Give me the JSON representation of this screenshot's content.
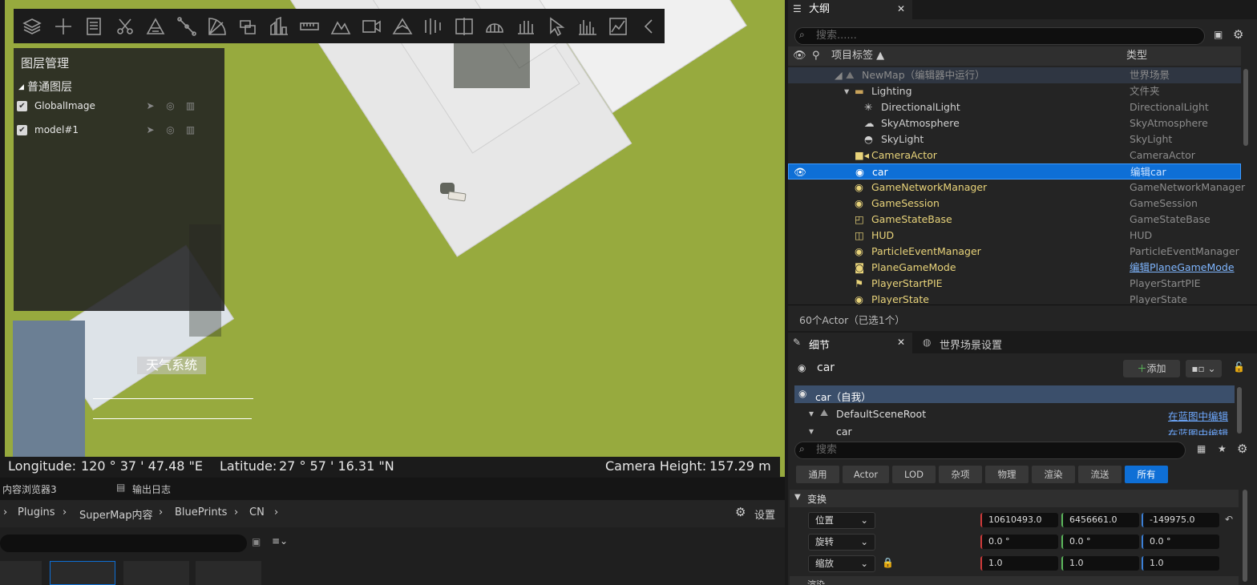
{
  "toolbar": {
    "icons": [
      "layers-icon",
      "plus-icon",
      "list-icon",
      "scissors-icon",
      "terrain-icon",
      "measure-icon",
      "sector-icon",
      "layers-edit-icon",
      "buildings-icon",
      "ruler-icon",
      "mountain-icon",
      "video-icon",
      "profile-icon",
      "split-icon",
      "compare-icon",
      "dome-icon",
      "flatten-icon",
      "pointer-icon",
      "bars-icon",
      "chart-icon",
      "collapse-icon"
    ]
  },
  "layer_panel": {
    "title": "图层管理",
    "group": "普通图层",
    "layers": [
      {
        "name": "GlobalImage",
        "checked": true
      },
      {
        "name": "model#1",
        "checked": true
      }
    ]
  },
  "weather_label": "天气系统",
  "status": {
    "lon_label": "Longitude:",
    "lon_value": "120 ° 37 ' 47.48 \"E",
    "lat_label": "Latitude:",
    "lat_value": "27 ° 57 ' 16.31 \"N",
    "cam_label": "Camera Height:",
    "cam_value": "157.29 m"
  },
  "content_tabs": {
    "browser": "内容浏览器3",
    "log": "输出日志"
  },
  "breadcrumb": {
    "items": [
      "Plugins",
      "SuperMap内容",
      "BluePrints",
      "CN"
    ],
    "settings": "设置"
  },
  "outliner": {
    "tab": "大纲",
    "search_placeholder": "搜索......",
    "col_label": "项目标签 ▲",
    "col_type": "类型",
    "rows": [
      {
        "name": "NewMap（编辑器中运行）",
        "type": "世界场景"
      },
      {
        "name": "Lighting",
        "type": "文件夹"
      },
      {
        "name": "DirectionalLight",
        "type": "DirectionalLight"
      },
      {
        "name": "SkyAtmosphere",
        "type": "SkyAtmosphere"
      },
      {
        "name": "SkyLight",
        "type": "SkyLight"
      },
      {
        "name": "CameraActor",
        "type": "CameraActor"
      },
      {
        "name": "car",
        "type": "编辑car"
      },
      {
        "name": "GameNetworkManager",
        "type": "GameNetworkManager"
      },
      {
        "name": "GameSession",
        "type": "GameSession"
      },
      {
        "name": "GameStateBase",
        "type": "GameStateBase"
      },
      {
        "name": "HUD",
        "type": "HUD"
      },
      {
        "name": "ParticleEventManager",
        "type": "ParticleEventManager"
      },
      {
        "name": "PlaneGameMode",
        "type": "编辑PlaneGameMode"
      },
      {
        "name": "PlayerStartPIE",
        "type": "PlayerStartPIE"
      },
      {
        "name": "PlayerState",
        "type": "PlayerState"
      }
    ],
    "footer": "60个Actor（已选1个）"
  },
  "details": {
    "tab": "细节",
    "tab2": "世界场景设置",
    "object": "car",
    "add": "添加",
    "self_row": "car（自我）",
    "root": "DefaultSceneRoot",
    "edit_bp": "在蓝图中编辑",
    "child": "car",
    "search_placeholder": "搜索",
    "filters": [
      "通用",
      "Actor",
      "LOD",
      "杂项",
      "物理",
      "渲染",
      "流送",
      "所有"
    ],
    "section": "变换",
    "transform": [
      {
        "label": "位置",
        "x": "10610493.0",
        "y": "6456661.0",
        "z": "-149975.0"
      },
      {
        "label": "旋转",
        "x": "0.0 °",
        "y": "0.0 °",
        "z": "0.0 °"
      },
      {
        "label": "缩放",
        "x": "1.0",
        "y": "1.0",
        "z": "1.0"
      }
    ],
    "next_section": "渲染"
  },
  "colors": {
    "accent": "#0e6fd6",
    "grass": "#97aa3e",
    "selected_row": "#0e6fd6"
  }
}
